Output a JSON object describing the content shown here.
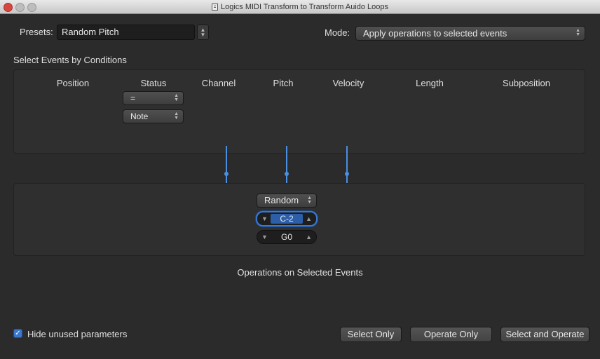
{
  "window": {
    "title": "Logics MIDI Transform to Transform Auido Loops"
  },
  "presets": {
    "label": "Presets:",
    "value": "Random Pitch"
  },
  "mode": {
    "label": "Mode:",
    "value": "Apply operations to selected events"
  },
  "conditions": {
    "section_title": "Select Events by Conditions",
    "columns": [
      "Position",
      "Status",
      "Channel",
      "Pitch",
      "Velocity",
      "Length",
      "Subposition"
    ],
    "status_operator": "=",
    "status_value": "Note"
  },
  "operations": {
    "section_title": "Operations on Selected Events",
    "pitch_operation": "Random",
    "pitch_value_1": "C-2",
    "pitch_value_2": "G0"
  },
  "footer": {
    "hide_unused_label": "Hide unused parameters",
    "hide_unused_checked": true,
    "select_only": "Select Only",
    "operate_only": "Operate Only",
    "select_and_operate": "Select and Operate"
  },
  "colors": {
    "accent": "#3a78d0",
    "background": "#2b2b2b"
  }
}
